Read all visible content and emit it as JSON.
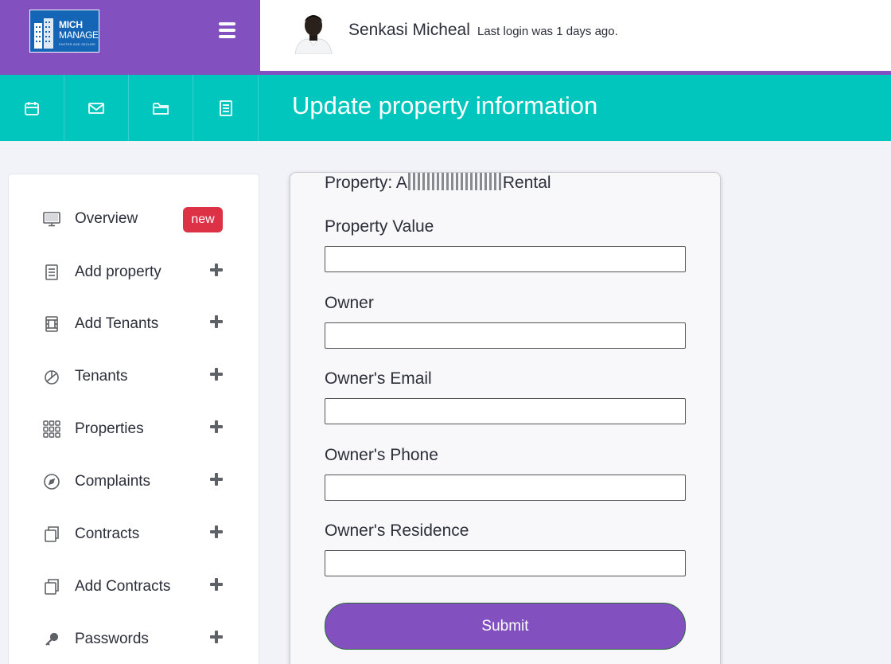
{
  "colors": {
    "brand_purple": "#8350c0",
    "teal": "#01c6be",
    "badge_red": "#dd3246",
    "logo_blue": "#1565b6"
  },
  "logo": {
    "line1": "MICH",
    "line2": "MANAGE",
    "tagline": "FASTER AND SECURE",
    "icon": "building-logo"
  },
  "header": {
    "menu_icon": "hamburger-icon",
    "user_name": "Senkasi Micheal",
    "last_login": "Last login was 1 days ago."
  },
  "quick_icons": [
    "calendar-icon",
    "mail-icon",
    "folder-icon",
    "document-icon"
  ],
  "page_title": "Update property information",
  "sidebar": {
    "items": [
      {
        "label": "Overview",
        "icon": "monitor-icon",
        "badge": "new"
      },
      {
        "label": "Add property",
        "icon": "document-icon"
      },
      {
        "label": "Add Tenants",
        "icon": "film-icon"
      },
      {
        "label": "Tenants",
        "icon": "pie-chart-icon"
      },
      {
        "label": "Properties",
        "icon": "grid-icon"
      },
      {
        "label": "Complaints",
        "icon": "compass-icon"
      },
      {
        "label": "Contracts",
        "icon": "copy-icon"
      },
      {
        "label": "Add Contracts",
        "icon": "copy-icon"
      },
      {
        "label": "Passwords",
        "icon": "key-icon"
      }
    ]
  },
  "form": {
    "property_prefix": "Property: A",
    "property_suffix": "Rental",
    "fields": [
      {
        "label": "Property Value",
        "value": ""
      },
      {
        "label": "Owner",
        "value": ""
      },
      {
        "label": "Owner's Email",
        "value": ""
      },
      {
        "label": "Owner's Phone",
        "value": ""
      },
      {
        "label": "Owner's Residence",
        "value": ""
      }
    ],
    "submit_label": "Submit"
  }
}
